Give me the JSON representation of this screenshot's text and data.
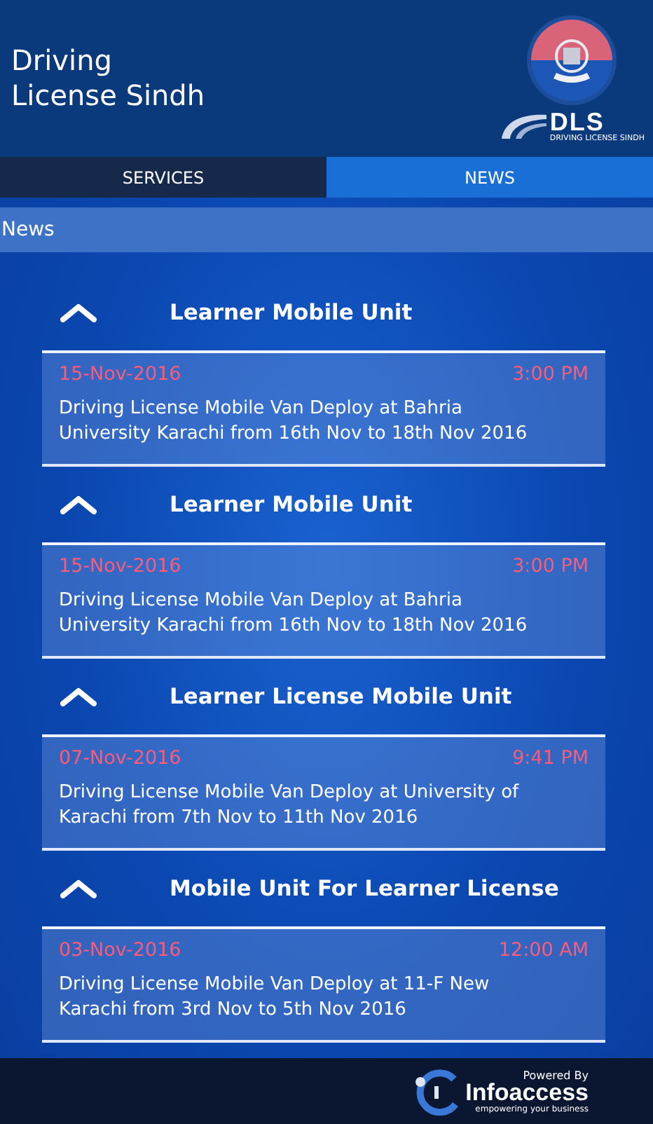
{
  "header": {
    "title_line_1": "Driving",
    "title_line_2": "License Sindh",
    "logo": {
      "mark": "DLS",
      "name": "DRIVING LICENSE SINDH"
    }
  },
  "tabs": [
    {
      "label": "SERVICES",
      "selected": false
    },
    {
      "label": "NEWS",
      "selected": true
    }
  ],
  "section_title": "News",
  "news": [
    {
      "title": "Learner Mobile Unit",
      "expanded": true,
      "date": "15-Nov-2016",
      "time": "3:00 PM",
      "text": "Driving License Mobile Van Deploy at Bahria University Karachi from 16th Nov to 18th Nov 2016"
    },
    {
      "title": "Learner Mobile Unit",
      "expanded": true,
      "date": "15-Nov-2016",
      "time": "3:00 PM",
      "text": "Driving License Mobile Van Deploy at Bahria University Karachi from 16th Nov to 18th Nov 2016"
    },
    {
      "title": "Learner License Mobile Unit",
      "expanded": true,
      "date": "07-Nov-2016",
      "time": "9:41 PM",
      "text": "Driving License Mobile Van Deploy at University of Karachi from 7th Nov to 11th Nov 2016"
    },
    {
      "title": "Mobile Unit For Learner License",
      "expanded": true,
      "date": "03-Nov-2016",
      "time": "12:00 AM",
      "text": "Driving License Mobile Van Deploy at 11-F New Karachi from 3rd Nov to 5th Nov 2016"
    }
  ],
  "footer": {
    "powered_by": "Powered By",
    "brand": "Infoaccess",
    "tagline": "empowering your business"
  }
}
